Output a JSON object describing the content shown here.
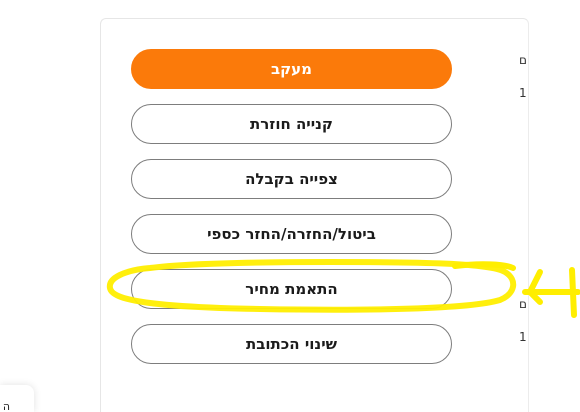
{
  "actions": {
    "track": "מעקב",
    "repurchase": "קנייה חוזרת",
    "view_receipt": "צפייה בקבלה",
    "cancel_return_refund": "ביטול/החזרה/החזר כספי",
    "price_match": "התאמת מחיר",
    "change_address": "שינוי הכתובת"
  },
  "right_edge": {
    "row1_char": "ם",
    "row2_char": "1",
    "row3_char": "ם",
    "row4_char": "1"
  },
  "bottom_left": {
    "partial_text": "ה"
  },
  "colors": {
    "accent": "#fb7a0a",
    "highlight": "#ffee00"
  },
  "annotation": {
    "icon": "highlighter-circle-with-arrow"
  }
}
